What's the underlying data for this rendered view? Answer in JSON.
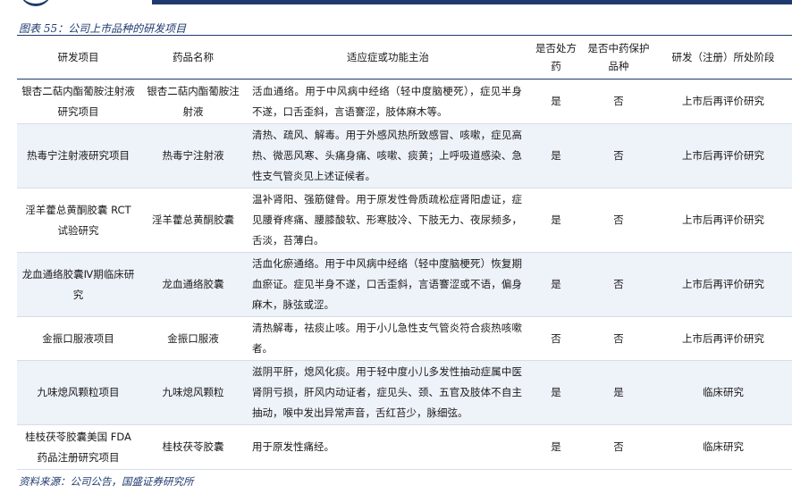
{
  "caption": "图表 55：公司上市品种的研发项目",
  "headers": [
    "研发项目",
    "药品名称",
    "适应症或功能主治",
    "是否处方药",
    "是否中药保护品种",
    "研发（注册）所处阶段"
  ],
  "rows": [
    {
      "project": "银杏二萜内酯葡胺注射液研究项目",
      "drug": "银杏二萜内酯葡胺注射液",
      "indication": "活血通络。用于中风病中经络（轻中度脑梗死），症见半身不遂，口舌歪斜，言语謇涩，肢体麻木等。",
      "prescription": "是",
      "protected": "否",
      "stage": "上市后再评价研究"
    },
    {
      "project": "热毒宁注射液研究项目",
      "drug": "热毒宁注射液",
      "indication": "清热、疏风、解毒。用于外感风热所致感冒、咳嗽，症见高热、微恶风寒、头痛身痛、咳嗽、痰黄；上呼吸道感染、急性支气管炎见上述证候者。",
      "prescription": "是",
      "protected": "否",
      "stage": "上市后再评价研究"
    },
    {
      "project": "淫羊藿总黄酮胶囊 RCT 试验研究",
      "drug": "淫羊藿总黄酮胶囊",
      "indication": "温补肾阳、强筋健骨。用于原发性骨质疏松症肾阳虚证，症见腰脊疼痛、腰膝酸软、形寒肢冷、下肢无力、夜尿频多，舌淡，苔薄白。",
      "prescription": "是",
      "protected": "否",
      "stage": "上市后再评价研究"
    },
    {
      "project": "龙血通络胶囊Ⅳ期临床研究",
      "drug": "龙血通络胶囊",
      "indication": "活血化瘀通络。用于中风病中经络（轻中度脑梗死）恢复期血瘀证。症见半身不遂，口舌歪斜，言语謇涩或不语，偏身麻木，脉弦或涩。",
      "prescription": "是",
      "protected": "否",
      "stage": "上市后再评价研究"
    },
    {
      "project": "金振口服液项目",
      "drug": "金振口服液",
      "indication": "清热解毒，祛痰止咳。用于小儿急性支气管炎符合痰热咳嗽者。",
      "prescription": "否",
      "protected": "否",
      "stage": "上市后再评价研究"
    },
    {
      "project": "九味熄风颗粒项目",
      "drug": "九味熄风颗粒",
      "indication": "滋阴平肝，熄风化痰。用于轻中度小儿多发性抽动症属中医肾阴亏损，肝风内动证者，症见头、颈、五官及肢体不自主抽动，喉中发出异常声音，舌红苔少，脉细弦。",
      "prescription": "是",
      "protected": "是",
      "stage": "临床研究"
    },
    {
      "project": "桂枝茯苓胶囊美国 FDA 药品注册研究项目",
      "drug": "桂枝茯苓胶囊",
      "indication": "用于原发性痛经。",
      "prescription": "是",
      "protected": "否",
      "stage": "临床研究"
    }
  ],
  "source": "资料来源：公司公告，国盛证券研究所"
}
